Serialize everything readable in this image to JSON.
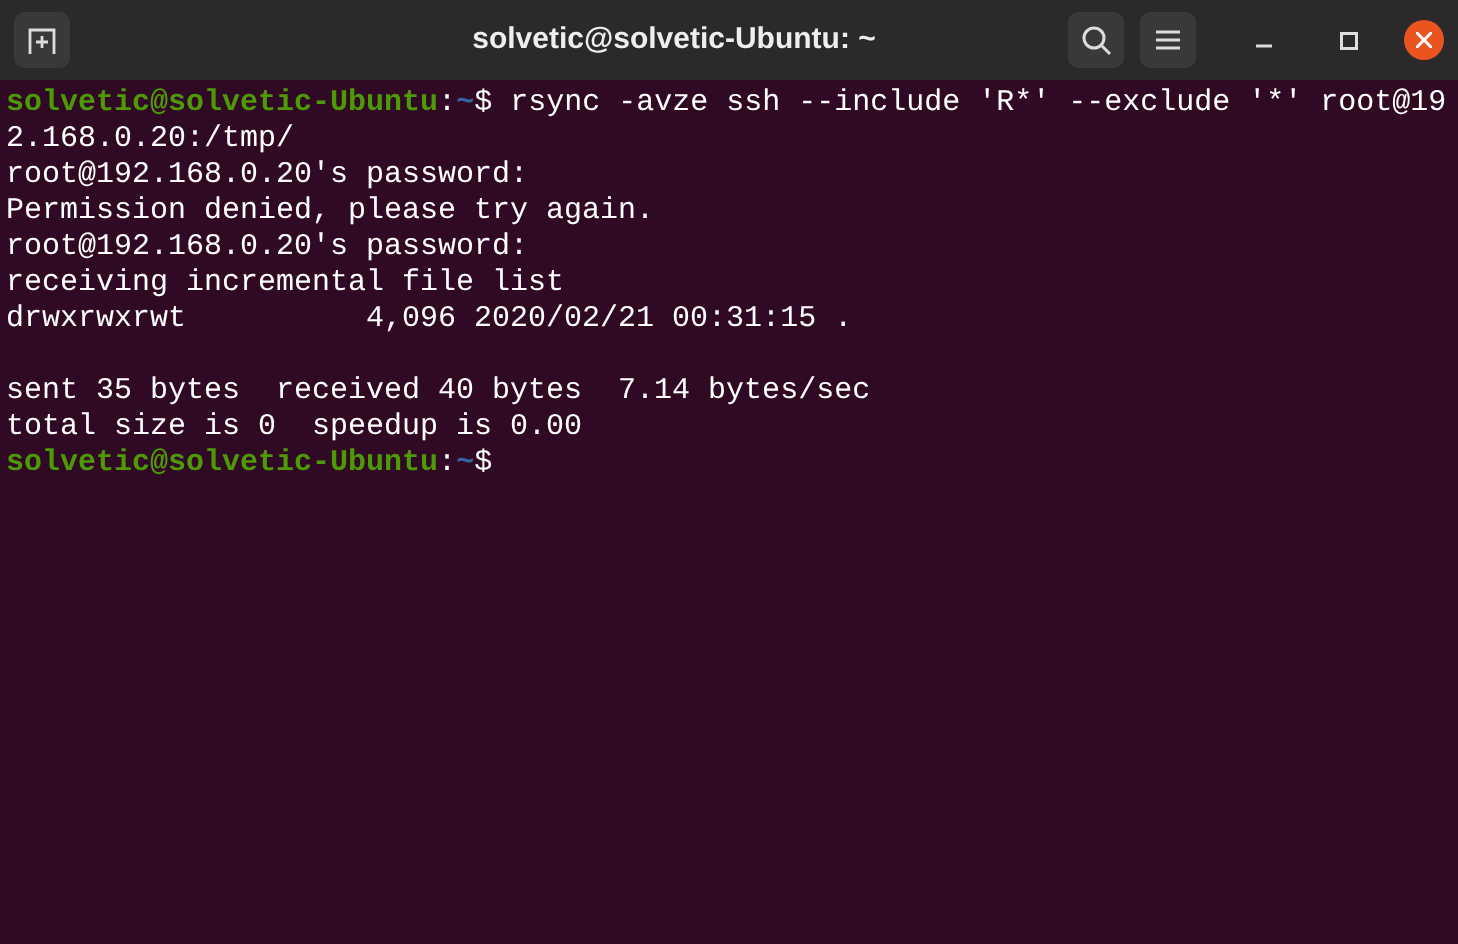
{
  "window": {
    "title": "solvetic@solvetic-Ubuntu: ~"
  },
  "terminal": {
    "lines": [
      {
        "kind": "prompt",
        "user_host": "solvetic@solvetic-Ubuntu",
        "separator": ":",
        "path": "~",
        "symbol": "$",
        "command": " rsync -avze ssh --include 'R*' --exclude '*' root@19"
      },
      {
        "kind": "output",
        "text": "2.168.0.20:/tmp/"
      },
      {
        "kind": "output",
        "text": "root@192.168.0.20's password:"
      },
      {
        "kind": "output",
        "text": "Permission denied, please try again."
      },
      {
        "kind": "output",
        "text": "root@192.168.0.20's password:"
      },
      {
        "kind": "output",
        "text": "receiving incremental file list"
      },
      {
        "kind": "output",
        "text": "drwxrwxrwt          4,096 2020/02/21 00:31:15 ."
      },
      {
        "kind": "blank"
      },
      {
        "kind": "output",
        "text": "sent 35 bytes  received 40 bytes  7.14 bytes/sec"
      },
      {
        "kind": "output",
        "text": "total size is 0  speedup is 0.00"
      },
      {
        "kind": "prompt",
        "user_host": "solvetic@solvetic-Ubuntu",
        "separator": ":",
        "path": "~",
        "symbol": "$"
      }
    ]
  }
}
